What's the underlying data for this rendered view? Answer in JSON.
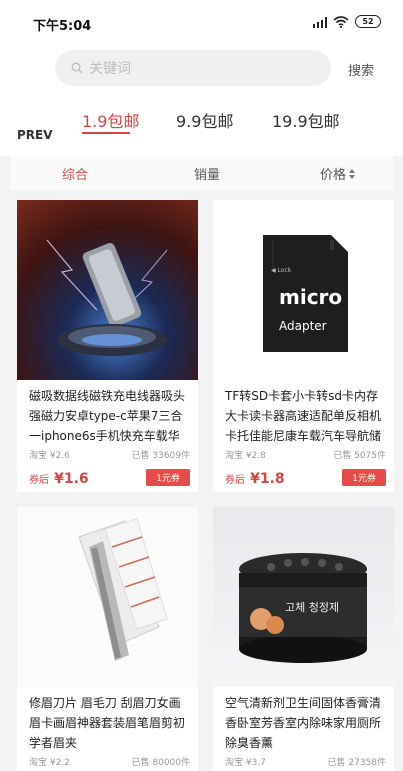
{
  "status": {
    "time": "下午5:04",
    "battery": "52"
  },
  "search": {
    "placeholder": "关键词",
    "button": "搜索"
  },
  "tabs": [
    {
      "label": "1.9包邮"
    },
    {
      "label": "9.9包邮"
    },
    {
      "label": "19.9包邮"
    }
  ],
  "prev_label": "PREV",
  "sort": {
    "general": "综合",
    "sales": "销量",
    "price": "价格",
    "price_icon": "sort-arrows-icon"
  },
  "products": [
    {
      "title": "磁吸数据线磁铁充电线器吸头强磁力安卓type-c苹果7三合一iphone6s手机快充车载华为",
      "orig_price": "淘宝 ¥2.6",
      "sold": "已售 33609件",
      "after_label": "券后",
      "price": "¥1.6",
      "coupon": "1元券"
    },
    {
      "title": "TF转SD卡套小卡转sd卡内存大卡读卡器高速适配单反相机卡托佳能尼康车载汽车导航储",
      "orig_price": "淘宝 ¥2.8",
      "sold": "已售 5075件",
      "after_label": "券后",
      "price": "¥1.8",
      "coupon": "1元券",
      "image_text": {
        "lock": "◀ Lock",
        "brand": "micro SD",
        "sub": "Adapter"
      }
    },
    {
      "title": "修眉刀片 眉毛刀 刮眉刀女画眉卡画眉神器套装眉笔眉剪初学者眉夹",
      "orig_price": "淘宝 ¥2.2",
      "sold": "已售 80000件"
    },
    {
      "title": "空气清新剂卫生间固体香膏清香卧室芳香室内除味家用厕所除臭香薰",
      "orig_price": "淘宝 ¥3.7",
      "sold": "已售 27358件",
      "image_text": {
        "label": "고체 청정제"
      }
    }
  ]
}
